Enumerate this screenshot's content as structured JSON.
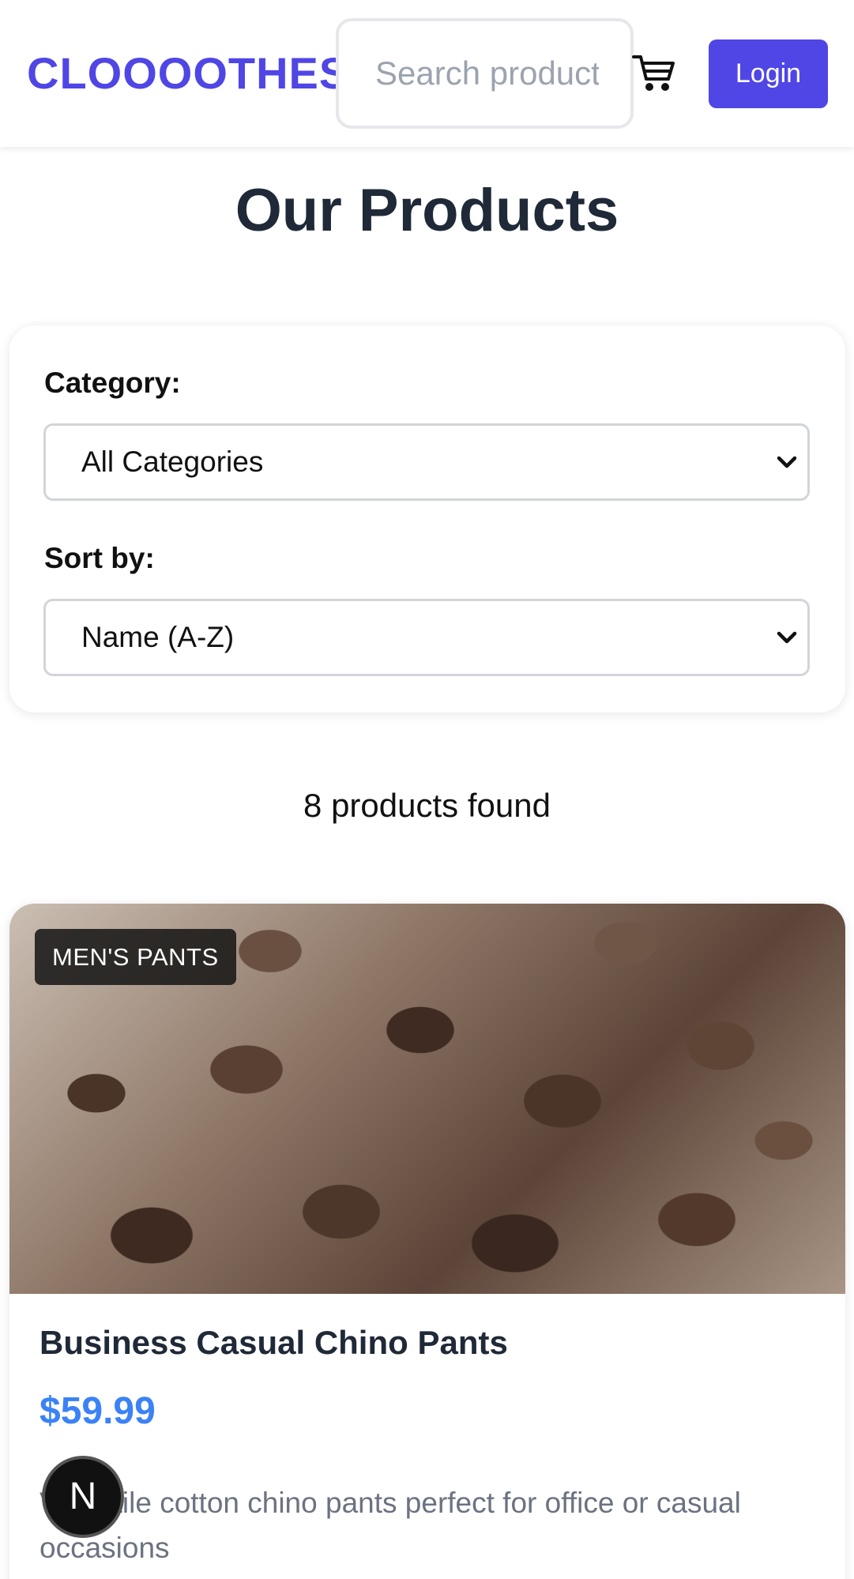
{
  "header": {
    "brand": "CLOOOOTHES",
    "search_placeholder": "Search products...",
    "cart_icon": "cart-icon",
    "login_label": "Login",
    "accent_color": "#4f46e5"
  },
  "main": {
    "title": "Our Products",
    "filters": {
      "category_label": "Category:",
      "category_selected": "All Categories",
      "sort_label": "Sort by:",
      "sort_selected": "Name (A-Z)"
    },
    "result_count": "8 products found",
    "products": [
      {
        "badge": "MEN'S PANTS",
        "name": "Business Casual Chino Pants",
        "price": "$59.99",
        "description": "Versatile cotton chino pants perfect for office or casual occasions",
        "price_color": "#3b82f6"
      }
    ]
  },
  "overlay": {
    "dev_badge_letter": "N"
  }
}
